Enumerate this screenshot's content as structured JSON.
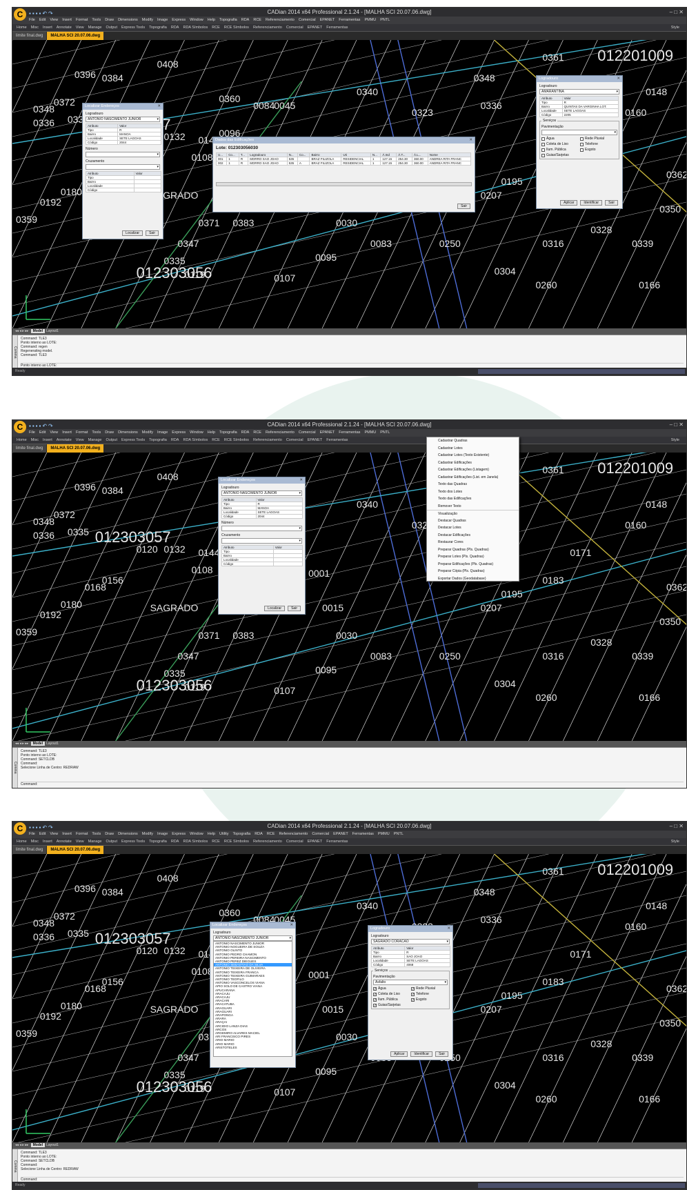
{
  "app": {
    "title": "CADian 2014 x64 Professional 2.1.24 - [MALHA SCI  20.07.06.dwg]",
    "logo": "C",
    "menu": [
      "File",
      "Edit",
      "View",
      "Insert",
      "Format",
      "Tools",
      "Draw",
      "Dimensions",
      "Modify",
      "Image",
      "Express",
      "Window",
      "Help",
      "Topografia",
      "RDA",
      "RCE",
      "Referenciamento",
      "Comercial",
      "EPANET",
      "Ferramentas",
      "PMMU",
      "PNTL"
    ],
    "menu3": [
      "File",
      "Edit",
      "View",
      "Insert",
      "Format",
      "Tools",
      "Draw",
      "Dimensions",
      "Modify",
      "Image",
      "Express",
      "Window",
      "Help",
      "Utility",
      "Topografia",
      "RDA",
      "RCE",
      "Referenciamento",
      "Comercial",
      "EPANET",
      "Ferramentas",
      "PMMU",
      "PNTL"
    ],
    "ribbon": [
      "Home",
      "Misc",
      "Insert",
      "Annotate",
      "View",
      "Manage",
      "Output",
      "Express Tools",
      "Topografia",
      "RDA",
      "RDA Símbolos",
      "RCE",
      "RCE Símbolos",
      "Referenciamento",
      "Comercial",
      "EPANET",
      "Ferramentas"
    ],
    "style_label": "Style",
    "doc_tabs": [
      "limite final.dwg",
      "MALHA SCI  20.07.06.dwg"
    ],
    "model_tabs": [
      "Model",
      "Layout1"
    ],
    "status_ready": "Ready",
    "cmd_side": "Comma",
    "pntl_label": "PNTL"
  },
  "drawing_labels": [
    "0408",
    "0396",
    "0384",
    "0372",
    "0360",
    "0335",
    "0348",
    "0336",
    "012303057",
    "0120",
    "0132",
    "0144",
    "0156",
    "0168",
    "0180",
    "0192",
    "0359",
    "0347",
    "0335",
    "012303056",
    "0119",
    "0107",
    "0095",
    "0083",
    "0045",
    "0015",
    "0030",
    "0340",
    "0348",
    "0336",
    "0361",
    "012201009",
    "0148",
    "0160",
    "0171",
    "0183",
    "0195",
    "0207",
    "0250",
    "0316",
    "0328",
    "0339",
    "0350",
    "0362",
    "0304",
    "0260",
    "0166",
    "0323",
    "0084",
    "0096",
    "0108",
    "0371",
    "0383",
    "0001",
    "SAGRADO"
  ],
  "shot1": {
    "cmd_lines": [
      "Command: TLE3",
      "Ponto interno ao LOTE:",
      "Command: regen",
      "Regenerating model.",
      "Command: TLE3"
    ],
    "cmd_input": "Ponto interno ao LOTE:",
    "localizar": {
      "title": "Localizar Endereços",
      "lbl_log": "Logradouro",
      "logradouro": "ANTONIO NASCIMENTO JUNIOR",
      "attr_head": [
        "Atributo",
        "Valor"
      ],
      "attrs": [
        [
          "Tipo",
          "R"
        ],
        [
          "Bairro",
          "MANOA"
        ],
        [
          "Localidade",
          "SETE LAGOAS"
        ],
        [
          "Código",
          "2044"
        ]
      ],
      "lbl_num": "Número",
      "lbl_cruz": "Cruzamento",
      "attrs2": [
        "Tipo",
        "Bairro",
        "Localidade",
        "Código"
      ],
      "btn_localizar": "Localizar",
      "btn_sair": "Sair"
    },
    "edif": {
      "title": "Dados das Edificações",
      "lote": "Lote: 012303056030",
      "headers": [
        "U...",
        "Co...",
        "T...",
        "Logradouro",
        "N...",
        "Co...",
        "Bairro",
        "Uti",
        "N...",
        "Á.Ind",
        "Á.T...",
        "Á.L...",
        "Nome"
      ],
      "rows": [
        [
          "001",
          "1",
          "R",
          "MORRO SAO JOAO",
          "535",
          "",
          "BRAZ FILIZOLA",
          "RESIDENCIAL",
          "1",
          "127.15",
          "254.30",
          "360.00",
          "ANDREA RITA FRANC"
        ],
        [
          "002",
          "1",
          "R",
          "MORRO SAO JOAO",
          "535",
          "A",
          "BRAZ FILIZOLA",
          "RESIDENCIAL",
          "1",
          "127.15",
          "254.30",
          "360.00",
          "ANDREA RITA FRANC"
        ]
      ],
      "btn_sair": "Sair"
    },
    "logr": {
      "title": "Logradouro",
      "lbl_log": "Logradouro",
      "logradouro": "AMARANTINA",
      "attrs": [
        [
          "Tipo",
          "R"
        ],
        [
          "Bairro",
          "QUINTAS DA VARGINHA LOT."
        ],
        [
          "Localidade",
          "SETE LAGOAS"
        ],
        [
          "Código",
          "2205"
        ]
      ],
      "servicos": "Serviços",
      "pav_label": "Pavimentação",
      "pav_value": "",
      "checks": [
        [
          "Água",
          false
        ],
        [
          "Rede Pluvial",
          false
        ],
        [
          "Coleta de Lixo",
          false
        ],
        [
          "Telefone",
          false
        ],
        [
          "Ilum. Pública",
          false
        ],
        [
          "Esgoto",
          false
        ],
        [
          "Guias/Sarjetas",
          false
        ]
      ],
      "btn_aplicar": "Aplicar",
      "btn_identificar": "Identificar",
      "btn_sair": "Sair"
    }
  },
  "shot2": {
    "cmd_lines": [
      "Command: TLE3",
      "Ponto interno ao LOTE:",
      "Command: SETCLDB",
      "Command:",
      "Selecione Linha de Centro: REDRAW"
    ],
    "cmd_input": "Command:",
    "menu_items": [
      "Cadastrar Quadras",
      "Cadastrar Lotes",
      "Cadastrar Lotes (Texto Existente)",
      "Cadastrar Edificações",
      "Cadastrar Edificações (Listagem)",
      "Cadastrar Edificações (List. em Janela)",
      "Texto das Quadras",
      "Texto dos Lotes",
      "Texto das Edificações",
      "Remover Texto",
      "Visualização",
      "Destacar Quadras",
      "Destacar Lotes",
      "Destacar Edificações",
      "Restaurar Cores",
      "Preparar Quadras (Pls. Quadras)",
      "Preparar Lotes (Pls. Quadras)",
      "Preparar Edificações (Pls. Quadras)",
      "Preparar Cópia (Pls. Quadras)",
      "Exportar Dados (Geodatabase)"
    ],
    "localizar": {
      "title": "Localizar Endereços",
      "logradouro": "ANTONIO NASCIMENTO JUNIOR"
    }
  },
  "shot3": {
    "cmd_lines": [
      "Command: TLE3",
      "Ponto interno ao LOTE:",
      "Command: SETCLDB",
      "Command:",
      "Selecione Linha de Centro: REDRAW"
    ],
    "cmd_input": "Command:",
    "localizar": {
      "title": "Localizar Endereços",
      "logradouro": "ANTONIO NASCIMENTO JUNIOR",
      "list": [
        "ANTONIO NASCIMENTO JUNIOR",
        "ANTONIO NOGUEIRA DE SOUZA",
        "ANTONIO OLINTO",
        "ANTONIO PEDRO CHAMON",
        "ANTONIO PEREIRA NASCIMENTO",
        "ANTONIO PEREZ DIEGUES",
        "ANTONIO SEBASTIAO DA SILVA",
        "ANTONIO TEIXEIRA DE OLIVEIRA",
        "ANTONIO TEIXEIRA FRANCA",
        "ANTONIO TEIXEIRA GUIMARAES",
        "ANTONIO TEOFILO",
        "ANTONIO VASCONCELOS VIANA",
        "APIO SOLO DE CASTRO VIANA",
        "APUCARANA",
        "ARACAJU",
        "ARACAJU",
        "ARACARI",
        "ARACATUBA",
        "ARAGUARI",
        "ARAGUARI",
        "ARAPONGA",
        "ARARA",
        "ARAÇAI",
        "ARCIDIO LANZA DIAS",
        "ARCOS",
        "ARGEMIRO ALVARES MACIEL",
        "ARI FRANCISCO PIRES",
        "ARIO MARIO",
        "ARIO MARIO",
        "ARISTOTELES"
      ],
      "selected": 6
    },
    "logr": {
      "title": "Logradouro",
      "logradouro": "SAGRADO CORACAO",
      "attrs": [
        [
          "Tipo",
          "R"
        ],
        [
          "Bairro",
          "SAO JOAO"
        ],
        [
          "Localidade",
          "SETE LAGOAS"
        ],
        [
          "Código",
          "4068"
        ]
      ],
      "pav_value": "Asfalto",
      "checks": [
        [
          "Água",
          true
        ],
        [
          "Rede Pluvial",
          true
        ],
        [
          "Coleta de Lixo",
          true
        ],
        [
          "Telefone",
          true
        ],
        [
          "Ilum. Pública",
          true
        ],
        [
          "Esgoto",
          true
        ],
        [
          "Guias/Sarjetas",
          true
        ]
      ]
    }
  }
}
